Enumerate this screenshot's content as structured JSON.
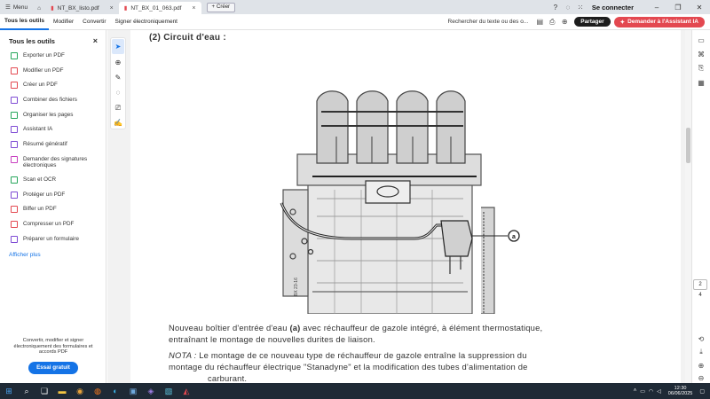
{
  "titlebar": {
    "menu_label": "Menu",
    "tabs": [
      {
        "label": "NT_BX_listo.pdf"
      },
      {
        "label": "NT_BX_01_063.pdf"
      }
    ],
    "new_tab_label": "Créer",
    "signin_label": "Se connecter"
  },
  "toolbar": {
    "menus": [
      "Tous les outils",
      "Modifier",
      "Convertir",
      "Signer électroniquement"
    ],
    "search_placeholder": "Rechercher du texte ou des o...",
    "share_label": "Partager",
    "ai_label": "Demander à l'Assistant IA"
  },
  "sidebar": {
    "title": "Tous les outils",
    "items": [
      {
        "label": "Exporter un PDF",
        "icon": "export-pdf-icon",
        "color": "#26a65b"
      },
      {
        "label": "Modifier un PDF",
        "icon": "edit-pdf-icon",
        "color": "#e34850"
      },
      {
        "label": "Créer un PDF",
        "icon": "create-pdf-icon",
        "color": "#e34850"
      },
      {
        "label": "Combiner des fichiers",
        "icon": "combine-files-icon",
        "color": "#7e4bd4"
      },
      {
        "label": "Organiser les pages",
        "icon": "organize-pages-icon",
        "color": "#26a65b"
      },
      {
        "label": "Assistant IA",
        "icon": "ai-assistant-icon",
        "color": "#7e4bd4"
      },
      {
        "label": "Résumé génératif",
        "icon": "summary-icon",
        "color": "#7e4bd4"
      },
      {
        "label": "Demander des signatures électroniques",
        "icon": "request-signature-icon",
        "color": "#c83fc0"
      },
      {
        "label": "Scan et OCR",
        "icon": "scan-ocr-icon",
        "color": "#26a65b"
      },
      {
        "label": "Protéger un PDF",
        "icon": "protect-pdf-icon",
        "color": "#7e4bd4"
      },
      {
        "label": "Biffer un PDF",
        "icon": "redact-pdf-icon",
        "color": "#e34850"
      },
      {
        "label": "Compresser un PDF",
        "icon": "compress-pdf-icon",
        "color": "#e34850"
      },
      {
        "label": "Préparer un formulaire",
        "icon": "prepare-form-icon",
        "color": "#7e4bd4"
      }
    ],
    "more_label": "Afficher plus",
    "promo_text": "Convertir, modifier et signer électroniquement des formulaires et accords PDF",
    "trial_label": "Essai gratuit"
  },
  "document": {
    "heading": "(2)  Circuit d'eau :",
    "diagram_small_label": "BX 23-16",
    "callout_label": "a",
    "para1_line1_pre": "Nouveau boîtier d'entrée d'eau ",
    "para1_bold": "(a)",
    "para1_line1_post": " avec réchauffeur de gazole intégré, à élément thermostatique,",
    "para1_line2": "entraînant le montage de nouvelles durites de liaison.",
    "note_label": "NOTA :",
    "note_line1": " Le montage de ce nouveau type de réchauffeur de gazole entraîne la suppression du",
    "note_line2": "montage du réchauffeur électrique \"Stanadyne\" et la modification des tubes d'alimentation de",
    "note_line3": "carburant."
  },
  "navigation": {
    "current_page": "2",
    "total_pages": "4"
  },
  "taskbar": {
    "time": "12:30",
    "date": "06/06/2025"
  },
  "colors": {
    "accent": "#1473e6",
    "ai_button": "#e34850",
    "taskbar": "#1f2a36"
  }
}
